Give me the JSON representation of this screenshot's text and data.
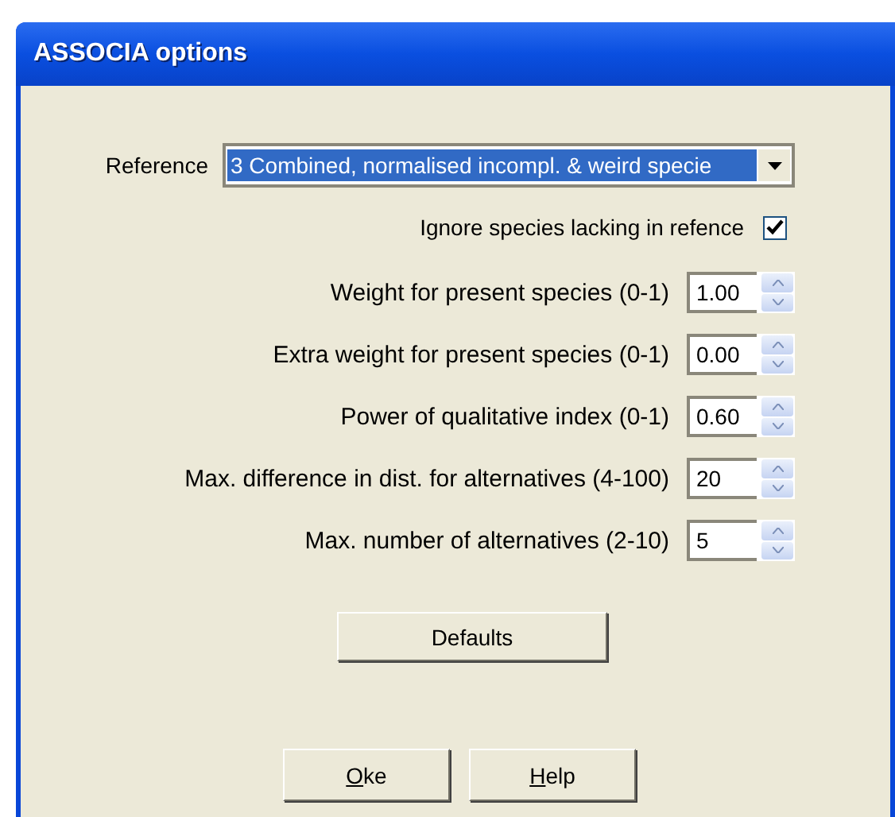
{
  "window": {
    "title": "ASSOCIA options"
  },
  "reference": {
    "label": "Reference",
    "value": "3 Combined, normalised incompl. & weird specie",
    "selected": true
  },
  "ignore_option": {
    "label": "Ignore species lacking in refence",
    "checked": true
  },
  "fields": [
    {
      "label": "Weight for present species (0-1)",
      "value": "1.00"
    },
    {
      "label": "Extra weight for present species (0-1)",
      "value": "0.00"
    },
    {
      "label": "Power of qualitative index (0-1)",
      "value": "0.60"
    },
    {
      "label": "Max. difference in dist. for alternatives (4-100)",
      "value": "20"
    },
    {
      "label": "Max. number of alternatives (2-10)",
      "value": "5"
    }
  ],
  "defaults_button": {
    "label": "Defaults"
  },
  "buttons": [
    {
      "label": "Oke",
      "underline_first": true
    },
    {
      "label": "Help",
      "underline_first": true
    }
  ]
}
